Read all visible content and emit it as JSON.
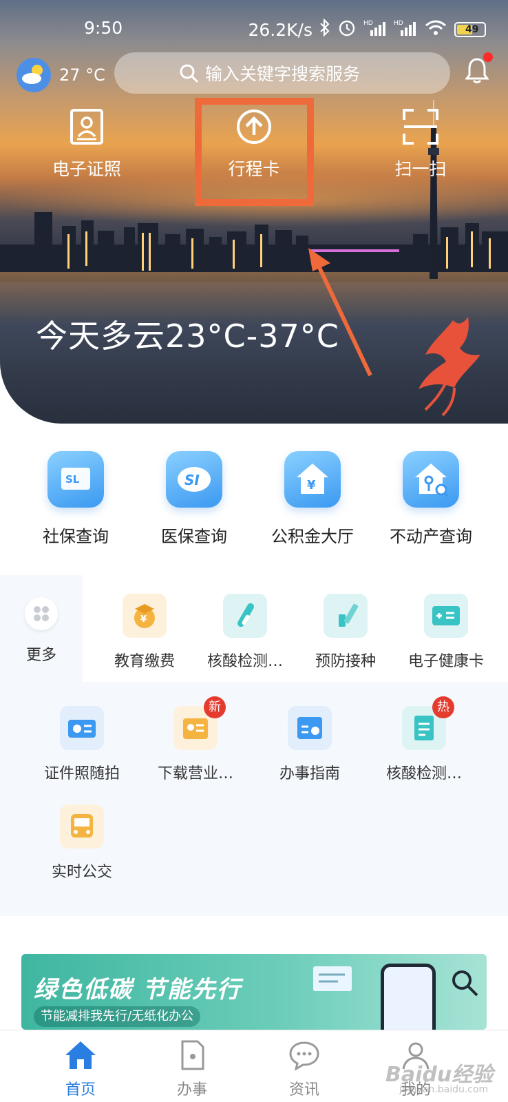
{
  "status_bar": {
    "time": "9:50",
    "net_speed": "26.2K/s",
    "signal_1_label": "HD",
    "signal_2_label": "HD",
    "battery": "49"
  },
  "header": {
    "temperature": "27 °C",
    "search_placeholder": "输入关键字搜索服务"
  },
  "quick_actions": [
    {
      "label": "电子证照",
      "icon": "id-card-icon"
    },
    {
      "label": "行程卡",
      "icon": "arrow-up-circle-icon"
    },
    {
      "label": "扫一扫",
      "icon": "scan-icon"
    }
  ],
  "hero": {
    "weather_text": "今天多云23°C-37°C"
  },
  "main_services": [
    {
      "label": "社保查询",
      "tile_text": "SL"
    },
    {
      "label": "医保查询",
      "tile_text": "SI"
    },
    {
      "label": "公积金大厅",
      "tile_text": "¥"
    },
    {
      "label": "不动产查询",
      "tile_text": ""
    }
  ],
  "more": {
    "label": "更多"
  },
  "secondary_row1": [
    {
      "label": "教育缴费",
      "tile_text": "¥"
    },
    {
      "label": "核酸检测…",
      "tile_text": ""
    },
    {
      "label": "预防接种",
      "tile_text": ""
    },
    {
      "label": "电子健康卡",
      "tile_text": ""
    }
  ],
  "secondary_row2": [
    {
      "label": "证件照随拍",
      "badge": ""
    },
    {
      "label": "下载营业…",
      "badge": "新"
    },
    {
      "label": "办事指南",
      "badge": ""
    },
    {
      "label": "核酸检测…",
      "badge": "热"
    }
  ],
  "secondary_row3": [
    {
      "label": "实时公交",
      "badge": ""
    }
  ],
  "banner": {
    "title": "绿色低碳 节能先行",
    "subtitle": "节能减排我先行/无纸化办公"
  },
  "tabs": [
    {
      "label": "首页",
      "active": true
    },
    {
      "label": "办事",
      "active": false
    },
    {
      "label": "资讯",
      "active": false
    },
    {
      "label": "我的",
      "active": false
    }
  ],
  "watermark": {
    "text": "Baidu经验",
    "sub": "jingyan.baidu.com"
  },
  "colors": {
    "accent": "#2a7de1",
    "highlight": "#ef6a3a",
    "badge": "#e53a2e"
  }
}
